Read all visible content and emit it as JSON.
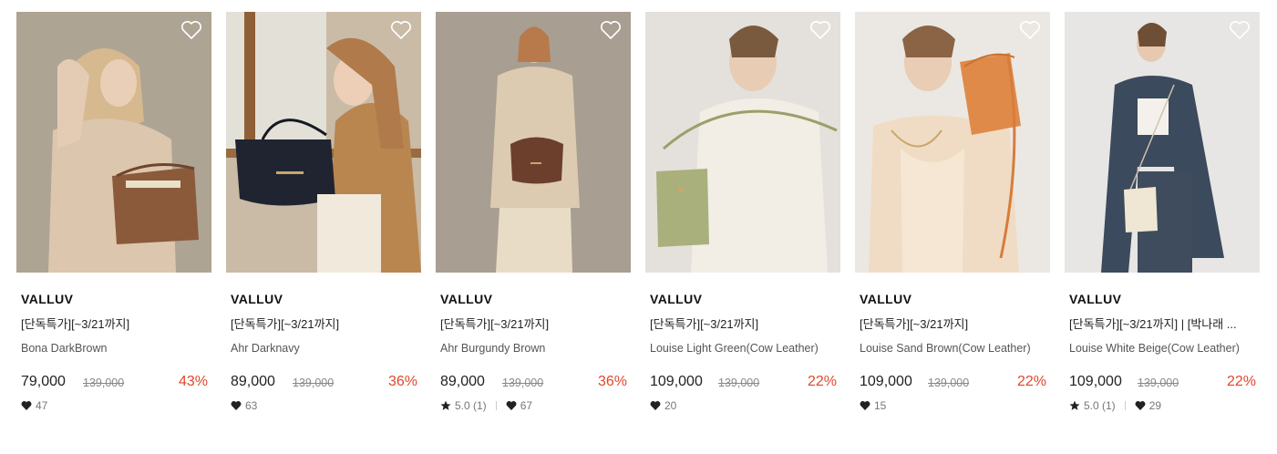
{
  "colors": {
    "discount": "#e0462b",
    "text": "#222222",
    "muted": "#777777"
  },
  "products": [
    {
      "brand": "VALLUV",
      "promo": "[단독특가][~3/21까지]",
      "name": "Bona DarkBrown",
      "price": "79,000",
      "original_price": "139,000",
      "discount": "43%",
      "rating": null,
      "likes": "47",
      "wishlist_icon": "heart-outline-icon"
    },
    {
      "brand": "VALLUV",
      "promo": "[단독특가][~3/21까지]",
      "name": "Ahr Darknavy",
      "price": "89,000",
      "original_price": "139,000",
      "discount": "36%",
      "rating": null,
      "likes": "63",
      "wishlist_icon": "heart-outline-icon"
    },
    {
      "brand": "VALLUV",
      "promo": "[단독특가][~3/21까지]",
      "name": "Ahr Burgundy Brown",
      "price": "89,000",
      "original_price": "139,000",
      "discount": "36%",
      "rating": "5.0 (1)",
      "likes": "67",
      "wishlist_icon": "heart-outline-icon"
    },
    {
      "brand": "VALLUV",
      "promo": "[단독특가][~3/21까지]",
      "name": "Louise Light Green(Cow Leather)",
      "price": "109,000",
      "original_price": "139,000",
      "discount": "22%",
      "rating": null,
      "likes": "20",
      "wishlist_icon": "heart-outline-icon"
    },
    {
      "brand": "VALLUV",
      "promo": "[단독특가][~3/21까지]",
      "name": "Louise Sand Brown(Cow Leather)",
      "price": "109,000",
      "original_price": "139,000",
      "discount": "22%",
      "rating": null,
      "likes": "15",
      "wishlist_icon": "heart-outline-icon"
    },
    {
      "brand": "VALLUV",
      "promo": "[단독특가][~3/21까지] | [박나래 ...",
      "name": "Louise White Beige(Cow Leather)",
      "price": "109,000",
      "original_price": "139,000",
      "discount": "22%",
      "rating": "5.0 (1)",
      "likes": "29",
      "wishlist_icon": "heart-outline-icon"
    }
  ]
}
